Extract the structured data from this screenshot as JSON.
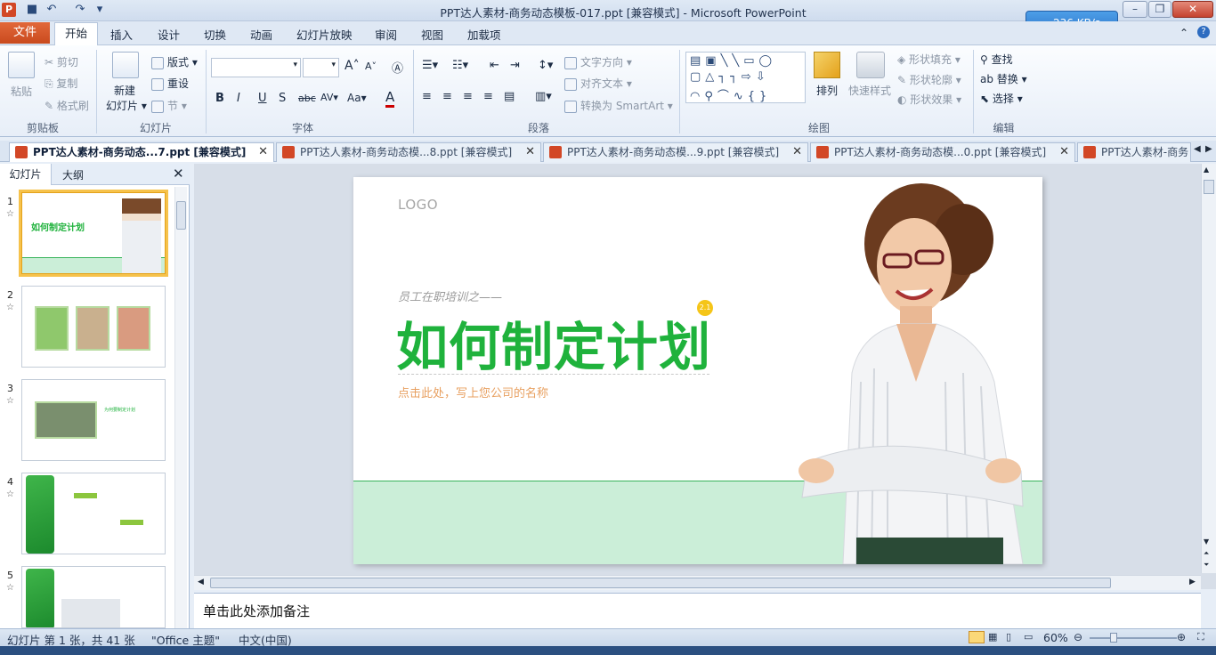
{
  "window": {
    "title": "PPT达人素材-商务动态模板-017.ppt [兼容模式]  -  Microsoft PowerPoint",
    "app_icon": "P",
    "min": "–",
    "max": "❐",
    "close": "✕"
  },
  "network": {
    "speed": "236 KB/s"
  },
  "ribbon_tabs": [
    "文件",
    "开始",
    "插入",
    "设计",
    "切换",
    "动画",
    "幻灯片放映",
    "审阅",
    "视图",
    "加载项"
  ],
  "clipboard": {
    "paste": "粘贴",
    "cut": "剪切",
    "copy": "复制",
    "format_painter": "格式刷",
    "group": "剪贴板"
  },
  "slides_group": {
    "new_slide_1": "新建",
    "new_slide_2": "幻灯片",
    "layout": "版式",
    "reset": "重设",
    "section": "节",
    "group": "幻灯片"
  },
  "font_group": {
    "group": "字体"
  },
  "paragraph": {
    "text_direction": "文字方向",
    "align_text": "对齐文本",
    "convert_smartart": "转换为 SmartArt",
    "group": "段落"
  },
  "drawing": {
    "arrange": "排列",
    "quick_styles": "快速样式",
    "shape_fill": "形状填充",
    "shape_outline": "形状轮廓",
    "shape_effects": "形状效果",
    "group": "绘图"
  },
  "editing": {
    "find": "查找",
    "replace": "替换",
    "select": "选择",
    "group": "编辑"
  },
  "doc_tabs": [
    {
      "label": "PPT达人素材-商务动态...7.ppt [兼容模式]",
      "active": true
    },
    {
      "label": "PPT达人素材-商务动态模...8.ppt [兼容模式]",
      "active": false
    },
    {
      "label": "PPT达人素材-商务动态模...9.ppt [兼容模式]",
      "active": false
    },
    {
      "label": "PPT达人素材-商务动态模...0.ppt [兼容模式]",
      "active": false
    },
    {
      "label": "PPT达人素材-商务",
      "active": false
    }
  ],
  "left_pane": {
    "tab_slides": "幻灯片",
    "tab_outline": "大纲",
    "close": "✕"
  },
  "thumbs": [
    {
      "num": "1",
      "star": "☆",
      "title": "如何制定计划"
    },
    {
      "num": "2",
      "star": "☆"
    },
    {
      "num": "3",
      "star": "☆",
      "title": "为何要制定计划"
    },
    {
      "num": "4",
      "star": "☆"
    },
    {
      "num": "5",
      "star": "☆"
    }
  ],
  "slide": {
    "logo": "LOGO",
    "subtitle_top": "员工在职培训之——",
    "title": "如何制定计划",
    "badge": "2.1",
    "company": "点击此处，写上您公司的名称"
  },
  "notes": {
    "placeholder": "单击此处添加备注"
  },
  "status": {
    "slide_info": "幻灯片 第 1 张，共 41 张",
    "theme": "\"Office 主题\"",
    "language": "中文(中国)",
    "zoom": "60%"
  },
  "colors": {
    "title_green": "#1fb23c",
    "band_green": "#cbeed8",
    "file_tab": "#c94a1e",
    "company_orange": "#e8a060"
  }
}
